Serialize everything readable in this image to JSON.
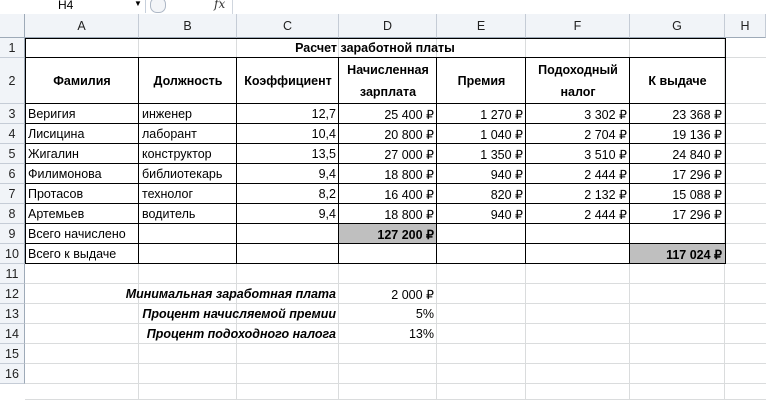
{
  "formula_bar": {
    "name_box": "H4",
    "fx_label": "fx",
    "formula": ""
  },
  "columns": [
    "A",
    "B",
    "C",
    "D",
    "E",
    "F",
    "G",
    "H"
  ],
  "rows": [
    "1",
    "2",
    "3",
    "4",
    "5",
    "6",
    "7",
    "8",
    "9",
    "10",
    "11",
    "12",
    "13",
    "14",
    "15",
    "16"
  ],
  "sheet": {
    "title": "Расчет заработной платы",
    "headers": {
      "a": "Фамилия",
      "b": "Должность",
      "c": "Коэффициент",
      "d1": "Начисленная",
      "d2": "зарплата",
      "e": "Премия",
      "f1": "Подоходный",
      "f2": "налог",
      "g": "К выдаче"
    },
    "employees": [
      {
        "name": "Веригия",
        "position": "инженер",
        "coef": "12,7",
        "salary": "25 400 ₽",
        "bonus": "1 270 ₽",
        "tax": "3 302 ₽",
        "payout": "23 368 ₽"
      },
      {
        "name": "Лисицина",
        "position": "лаборант",
        "coef": "10,4",
        "salary": "20 800 ₽",
        "bonus": "1 040 ₽",
        "tax": "2 704 ₽",
        "payout": "19 136 ₽"
      },
      {
        "name": "Жигалин",
        "position": "конструктор",
        "coef": "13,5",
        "salary": "27 000 ₽",
        "bonus": "1 350 ₽",
        "tax": "3 510 ₽",
        "payout": "24 840 ₽"
      },
      {
        "name": "Филимонова",
        "position": "библиотекарь",
        "coef": "9,4",
        "salary": "18 800 ₽",
        "bonus": "940 ₽",
        "tax": "2 444 ₽",
        "payout": "17 296 ₽"
      },
      {
        "name": "Протасов",
        "position": "технолог",
        "coef": "8,2",
        "salary": "16 400 ₽",
        "bonus": "820 ₽",
        "tax": "2 132 ₽",
        "payout": "15 088 ₽"
      },
      {
        "name": "Артемьев",
        "position": "водитель",
        "coef": "9,4",
        "salary": "18 800 ₽",
        "bonus": "940 ₽",
        "tax": "2 444 ₽",
        "payout": "17 296 ₽"
      }
    ],
    "total_accrued_label": "Всего начислено",
    "total_accrued_value": "127 200 ₽",
    "total_payout_label": "Всего к выдаче",
    "total_payout_value": "117 024 ₽",
    "params": [
      {
        "label": "Минимальная заработная плата",
        "value": "2 000 ₽"
      },
      {
        "label": "Процент начисляемой премии",
        "value": "5%"
      },
      {
        "label": "Процент подоходного налога",
        "value": "13%"
      }
    ]
  },
  "colors": {
    "header_bg": "#f1f4f8",
    "gridline": "#dadcdd",
    "total_fill": "#bfbfbf"
  }
}
